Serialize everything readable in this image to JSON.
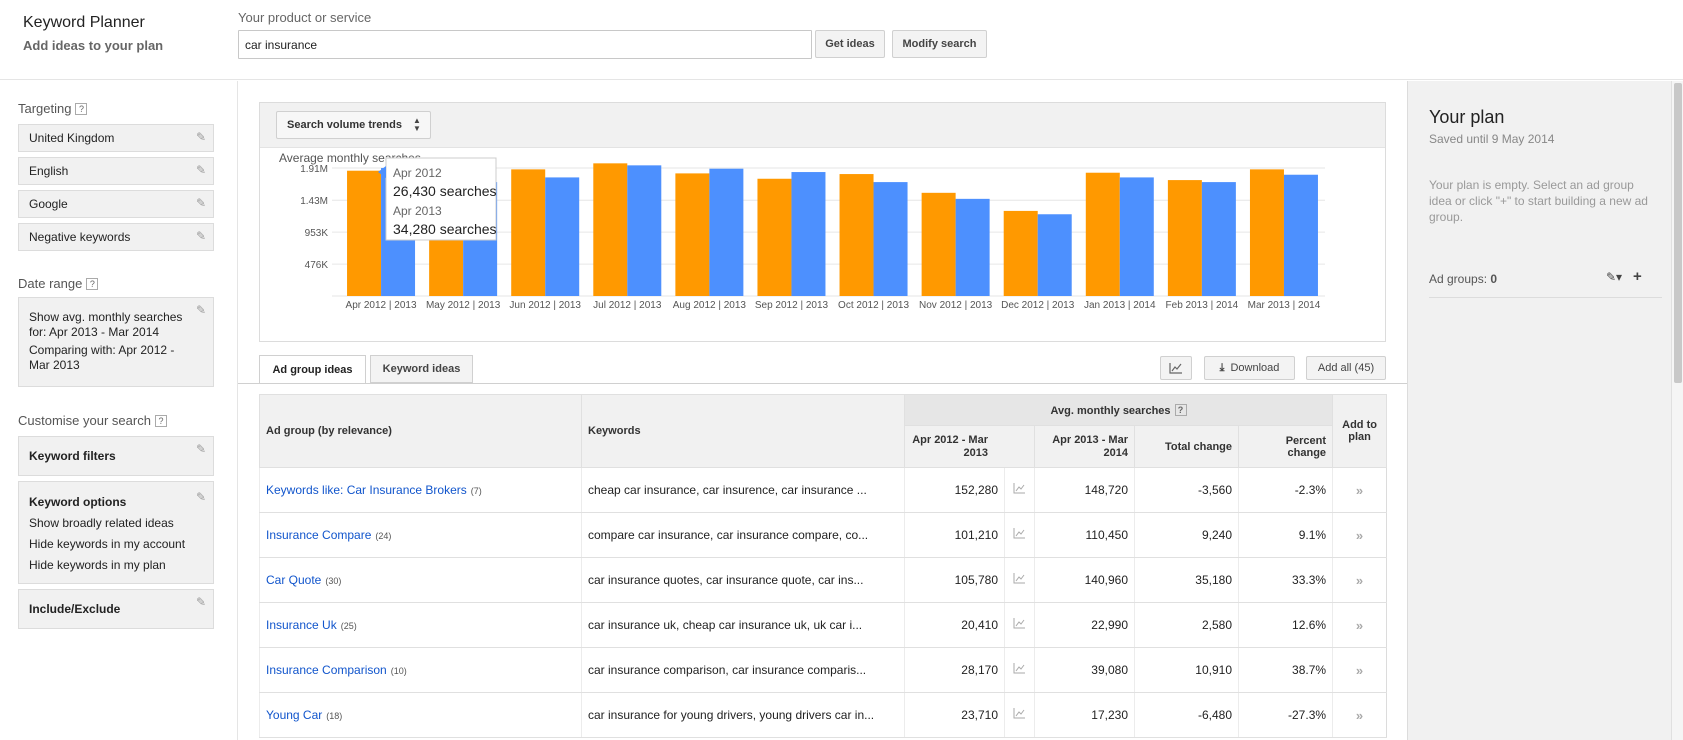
{
  "header": {
    "app_title": "Keyword Planner",
    "app_subtitle": "Add ideas to your plan",
    "product_label": "Your product or service",
    "product_value": "car insurance",
    "get_ideas_label": "Get ideas",
    "modify_search_label": "Modify search"
  },
  "sidebar": {
    "targeting_title": "Targeting",
    "targeting_items": [
      "United Kingdom",
      "English",
      "Google",
      "Negative keywords"
    ],
    "date_range_title": "Date range",
    "date_range_show": "Show avg. monthly searches for: Apr 2013 - Mar 2014",
    "date_range_compare": "Comparing with: Apr 2012 - Mar 2013",
    "customise_title": "Customise your search",
    "keyword_filters_label": "Keyword filters",
    "keyword_options_label": "Keyword options",
    "keyword_options_items": [
      "Show broadly related ideas",
      "Hide keywords in my account",
      "Hide keywords in my plan"
    ],
    "include_exclude_label": "Include/Exclude",
    "help_glyph": "?"
  },
  "plan": {
    "title": "Your plan",
    "saved": "Saved until 9 May 2014",
    "empty_msg": "Your plan is empty. Select an ad group idea or click \"+\" to start building a new ad group.",
    "ad_groups_label": "Ad groups:",
    "ad_groups_count": "0"
  },
  "chart_selector": "Search volume trends",
  "chart_data": {
    "type": "bar",
    "title": "Average monthly searches",
    "categories": [
      "Apr 2012 | 2013",
      "May 2012 | 2013",
      "Jun 2012 | 2013",
      "Jul 2012 | 2013",
      "Aug 2012 | 2013",
      "Sep 2012 | 2013",
      "Oct 2012 | 2013",
      "Nov 2012 | 2013",
      "Dec 2012 | 2013",
      "Jan 2013 | 2014",
      "Feb 2013 | 2014",
      "Mar 2013 | 2014"
    ],
    "series": [
      {
        "values": [
          1.87,
          1.72,
          1.89,
          1.98,
          1.83,
          1.75,
          1.82,
          1.54,
          1.27,
          1.84,
          1.73,
          1.89
        ],
        "color": "#ff9900"
      },
      {
        "values": [
          1.91,
          1.7,
          1.77,
          1.95,
          1.9,
          1.85,
          1.7,
          1.45,
          1.22,
          1.77,
          1.7,
          1.81
        ],
        "color": "#4d90fe"
      }
    ],
    "yticks": [
      "476K",
      "953K",
      "1.43M",
      "1.91M"
    ],
    "ytick_values": [
      0.476,
      0.953,
      1.43,
      1.91
    ],
    "ylim": [
      0,
      2.0
    ],
    "grid": true,
    "tooltip": {
      "line1": "Apr 2012",
      "line2": "26,430 searches",
      "line3": "Apr 2013",
      "line4": "34,280 searches"
    }
  },
  "tabs": {
    "ad_group_ideas": "Ad group ideas",
    "keyword_ideas": "Keyword ideas",
    "download": "Download",
    "add_all": "Add all (45)"
  },
  "table": {
    "headers": {
      "ad_group": "Ad group (by relevance)",
      "keywords": "Keywords",
      "avg_monthly": "Avg. monthly searches",
      "period1": "Apr 2012 - Mar 2013",
      "period2": "Apr 2013 - Mar 2014",
      "total_change": "Total change",
      "percent_change": "Percent change",
      "add_to_plan": "Add to plan"
    },
    "rows": [
      {
        "group": "Keywords like: Car Insurance Brokers",
        "count": "(7)",
        "keywords": "cheap car insurance, car insurence, car insurance ...",
        "p1": "152,280",
        "p2": "148,720",
        "total": "-3,560",
        "pct": "-2.3%"
      },
      {
        "group": "Insurance Compare",
        "count": "(24)",
        "keywords": "compare car insurance, car insurance compare, co...",
        "p1": "101,210",
        "p2": "110,450",
        "total": "9,240",
        "pct": "9.1%"
      },
      {
        "group": "Car Quote",
        "count": "(30)",
        "keywords": "car insurance quotes, car insurance quote, car ins...",
        "p1": "105,780",
        "p2": "140,960",
        "total": "35,180",
        "pct": "33.3%"
      },
      {
        "group": "Insurance Uk",
        "count": "(25)",
        "keywords": "car insurance uk, cheap car insurance uk, uk car i...",
        "p1": "20,410",
        "p2": "22,990",
        "total": "2,580",
        "pct": "12.6%"
      },
      {
        "group": "Insurance Comparison",
        "count": "(10)",
        "keywords": "car insurance comparison, car insurance comparis...",
        "p1": "28,170",
        "p2": "39,080",
        "total": "10,910",
        "pct": "38.7%"
      },
      {
        "group": "Young Car",
        "count": "(18)",
        "keywords": "car insurance for young drivers, young drivers car in...",
        "p1": "23,710",
        "p2": "17,230",
        "total": "-6,480",
        "pct": "-27.3%"
      }
    ]
  },
  "icons": {
    "pencil": "pencil-icon",
    "trend": "trend-chart-icon",
    "add": "add-to-plan-icon",
    "download": "download-icon",
    "plus": "plus-icon"
  }
}
